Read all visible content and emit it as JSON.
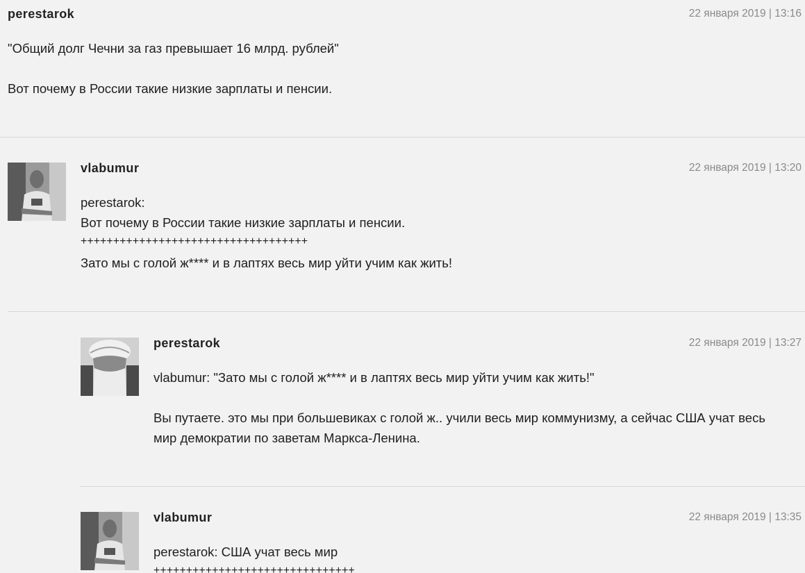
{
  "comments": [
    {
      "author": "perestarok",
      "date": "22 января 2019 | 13:16",
      "paragraphs": [
        "\"Общий долг Чечни за газ превышает 16 млрд. рублей\"",
        "Вот почему в России такие низкие зарплаты и пенсии."
      ]
    },
    {
      "author": "vlabumur",
      "date": "22 января 2019 | 13:20",
      "avatar": "man-in-tshirt-photo",
      "lines": [
        "perestarok:",
        "Вот почему в России такие низкие зарплаты и пенсии.",
        "+++++++++++++++++++++++++++++++++++",
        "Зато мы с голой ж**** и в лаптях весь мир уйти учим как жить!"
      ]
    },
    {
      "author": "perestarok",
      "date": "22 января 2019 | 13:27",
      "avatar": "old-man-turban-photo",
      "paragraphs": [
        "vlabumur: \"Зато мы с голой ж**** и в лаптях весь мир уйти учим как жить!\"",
        "Вы путаете. это мы при большевиках с голой ж.. учили весь мир коммунизму, а сейчас США учат весь мир демократии по заветам Маркса-Ленина."
      ]
    },
    {
      "author": "vlabumur",
      "date": "22 января 2019 | 13:35",
      "avatar": "man-in-tshirt-photo",
      "lines": [
        "perestarok: США учат весь мир",
        "+++++++++++++++++++++++++++++++"
      ]
    }
  ]
}
